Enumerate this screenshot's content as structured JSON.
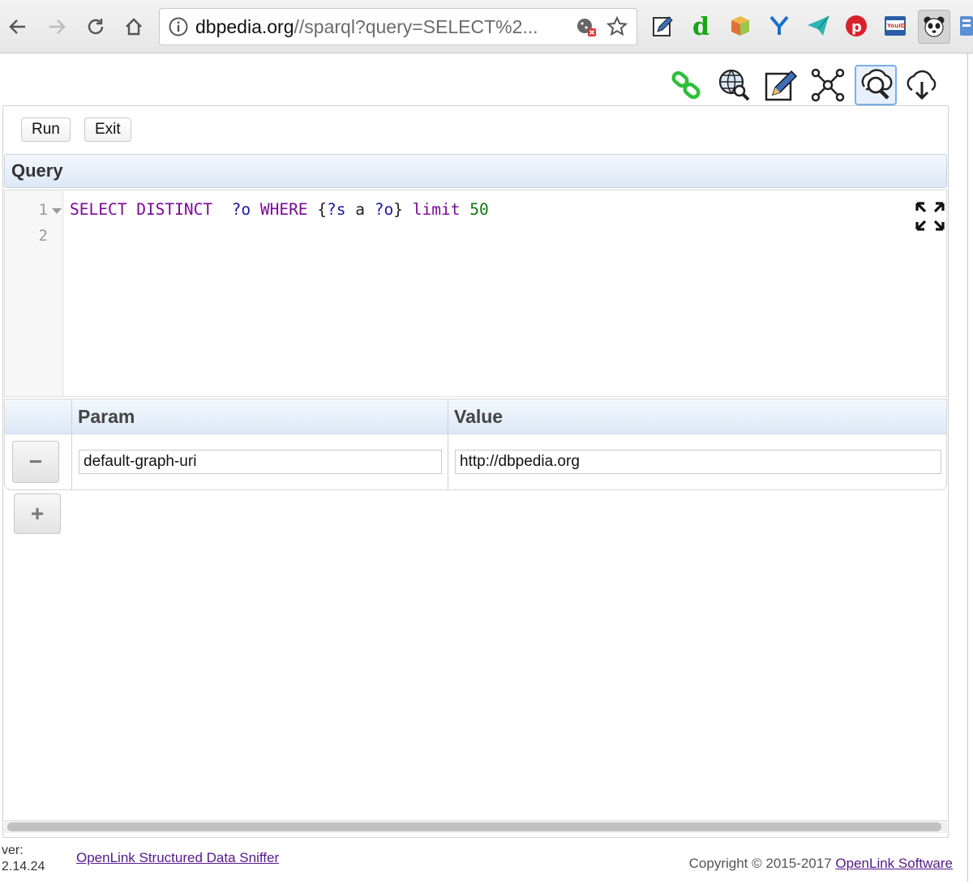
{
  "browser": {
    "url_host": "dbpedia.org",
    "url_path": "//sparql?query=SELECT%2...",
    "extensions": [
      "edit-note-icon",
      "d-extension-icon",
      "cube-extension-icon",
      "y-extension-icon",
      "paper-plane-icon",
      "pinterest-icon",
      "youid-icon",
      "panda-sniffer-icon",
      "blue-extension-icon"
    ],
    "youid_label": "YouID"
  },
  "toolbar": {
    "icons": [
      "link-icon",
      "globe-search-icon",
      "edit-icon",
      "graph-icon",
      "query-search-icon",
      "cloud-download-icon"
    ]
  },
  "actions": {
    "run_label": "Run",
    "exit_label": "Exit"
  },
  "query": {
    "header": "Query",
    "line_numbers": [
      "1",
      "2"
    ],
    "tokens": {
      "t1": "SELECT",
      "t2": "DISTINCT",
      "t3": "?o",
      "t4": "WHERE",
      "t5": "{",
      "t6": "?s",
      "t7": "a",
      "t8": "?o",
      "t9": "}",
      "t10": "limit",
      "t11": "50"
    }
  },
  "params": {
    "col_param": "Param",
    "col_value": "Value",
    "rows": [
      {
        "param": "default-graph-uri",
        "value": "http://dbpedia.org"
      }
    ],
    "remove_label": "−",
    "add_label": "+"
  },
  "footer": {
    "ver_label": "ver:",
    "version": "2.14.24",
    "app_link": "OpenLink Structured Data Sniffer",
    "copyright": "Copyright © 2015-2017",
    "company_link": "OpenLink Software"
  },
  "colors": {
    "keyword": "#7a0a98",
    "variable": "#1b1b9e",
    "number": "#127512",
    "link": "#551a8b",
    "header_bg": "#dde8f6"
  }
}
